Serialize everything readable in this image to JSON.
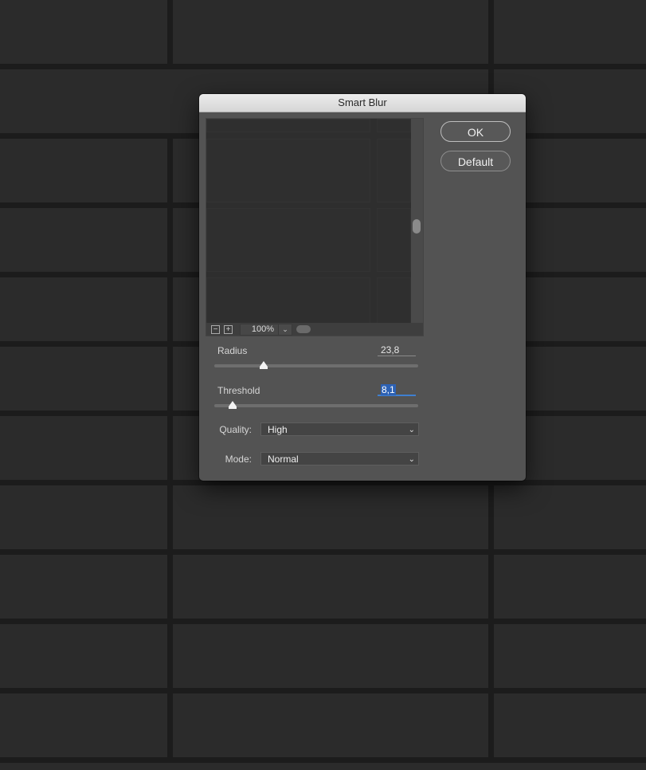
{
  "dialog": {
    "title": "Smart Blur",
    "ok_label": "OK",
    "default_label": "Default"
  },
  "preview": {
    "zoom": "100%",
    "zoom_out_symbol": "−",
    "zoom_in_symbol": "+",
    "dropdown_icon": "chevron-down-icon"
  },
  "radius": {
    "label": "Radius",
    "value": "23,8"
  },
  "threshold": {
    "label": "Threshold",
    "value": "8,1"
  },
  "quality": {
    "label": "Quality:",
    "value": "High"
  },
  "mode": {
    "label": "Mode:",
    "value": "Normal"
  },
  "colors": {
    "dialog_bg": "#535353",
    "selection": "#2d62b5",
    "focus_underline": "#3f7fd0"
  }
}
